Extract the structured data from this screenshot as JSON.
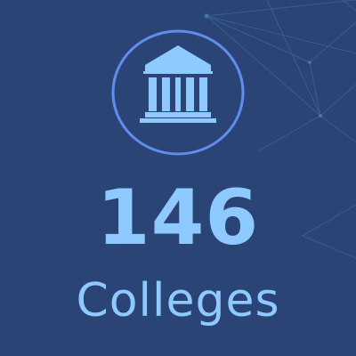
{
  "stat": {
    "value": "146",
    "label": "Colleges",
    "icon": "institution-icon"
  },
  "colors": {
    "background": "#2b4476",
    "accent": "#8ec9ff",
    "ring": "#5f8df0"
  }
}
